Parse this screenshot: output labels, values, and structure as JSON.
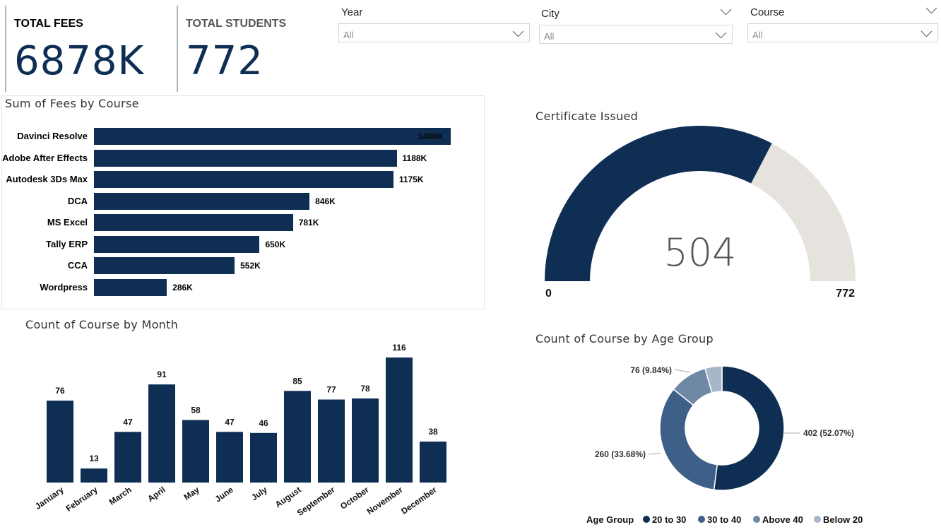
{
  "kpis": {
    "total_fees": {
      "title": "TOTAL FEES",
      "value": "6878K"
    },
    "total_students": {
      "title": "TOTAL STUDENTS",
      "value": "772"
    }
  },
  "filters": {
    "year": {
      "label": "Year",
      "value": "All"
    },
    "city": {
      "label": "City",
      "value": "All"
    },
    "course": {
      "label": "Course",
      "value": "All"
    }
  },
  "fees_by_course": {
    "title": "Sum of Fees by Course",
    "chart_data": {
      "type": "bar",
      "orientation": "horizontal",
      "categories": [
        "Davinci Resolve",
        "Adobe After Effects",
        "Autodesk 3Ds Max",
        "DCA",
        "MS Excel",
        "Tally ERP",
        "CCA",
        "Wordpress"
      ],
      "values": [
        1400,
        1188,
        1175,
        846,
        781,
        650,
        552,
        286
      ],
      "labels": [
        "1400K",
        "1188K",
        "1175K",
        "846K",
        "781K",
        "650K",
        "552K",
        "286K"
      ],
      "unit": "K",
      "xlim": [
        0,
        1400
      ]
    }
  },
  "certificate": {
    "title": "Certificate Issued",
    "chart_data": {
      "type": "gauge",
      "value": 504,
      "min": 0,
      "max": 772
    },
    "value_label": "504",
    "min_label": "0",
    "max_label": "772"
  },
  "course_by_month": {
    "title": "Count of Course by Month",
    "chart_data": {
      "type": "bar",
      "categories": [
        "January",
        "February",
        "March",
        "April",
        "May",
        "June",
        "July",
        "August",
        "September",
        "October",
        "November",
        "December"
      ],
      "values": [
        76,
        13,
        47,
        91,
        58,
        47,
        46,
        85,
        77,
        78,
        116,
        38
      ],
      "ylim": [
        0,
        116
      ]
    }
  },
  "age_group": {
    "title": "Count of Course by Age Group",
    "chart_data": {
      "type": "pie",
      "donut": true,
      "series": [
        {
          "name": "20 to 30",
          "value": 402,
          "label": "402 (52.07%)"
        },
        {
          "name": "30 to 40",
          "value": 260,
          "label": "260 (33.68%)"
        },
        {
          "name": "Above 40",
          "value": 76,
          "label": "76 (9.84%)"
        },
        {
          "name": "Below 20",
          "value": 34,
          "label": ""
        }
      ],
      "legend_title": "Age Group",
      "legend_position": "bottom"
    },
    "colors": [
      "#0e2e54",
      "#3e5f88",
      "#6f88a6",
      "#a7b6c8"
    ]
  },
  "colors": {
    "primary": "#0e2e54",
    "gauge_track": "#e6e2dd"
  }
}
